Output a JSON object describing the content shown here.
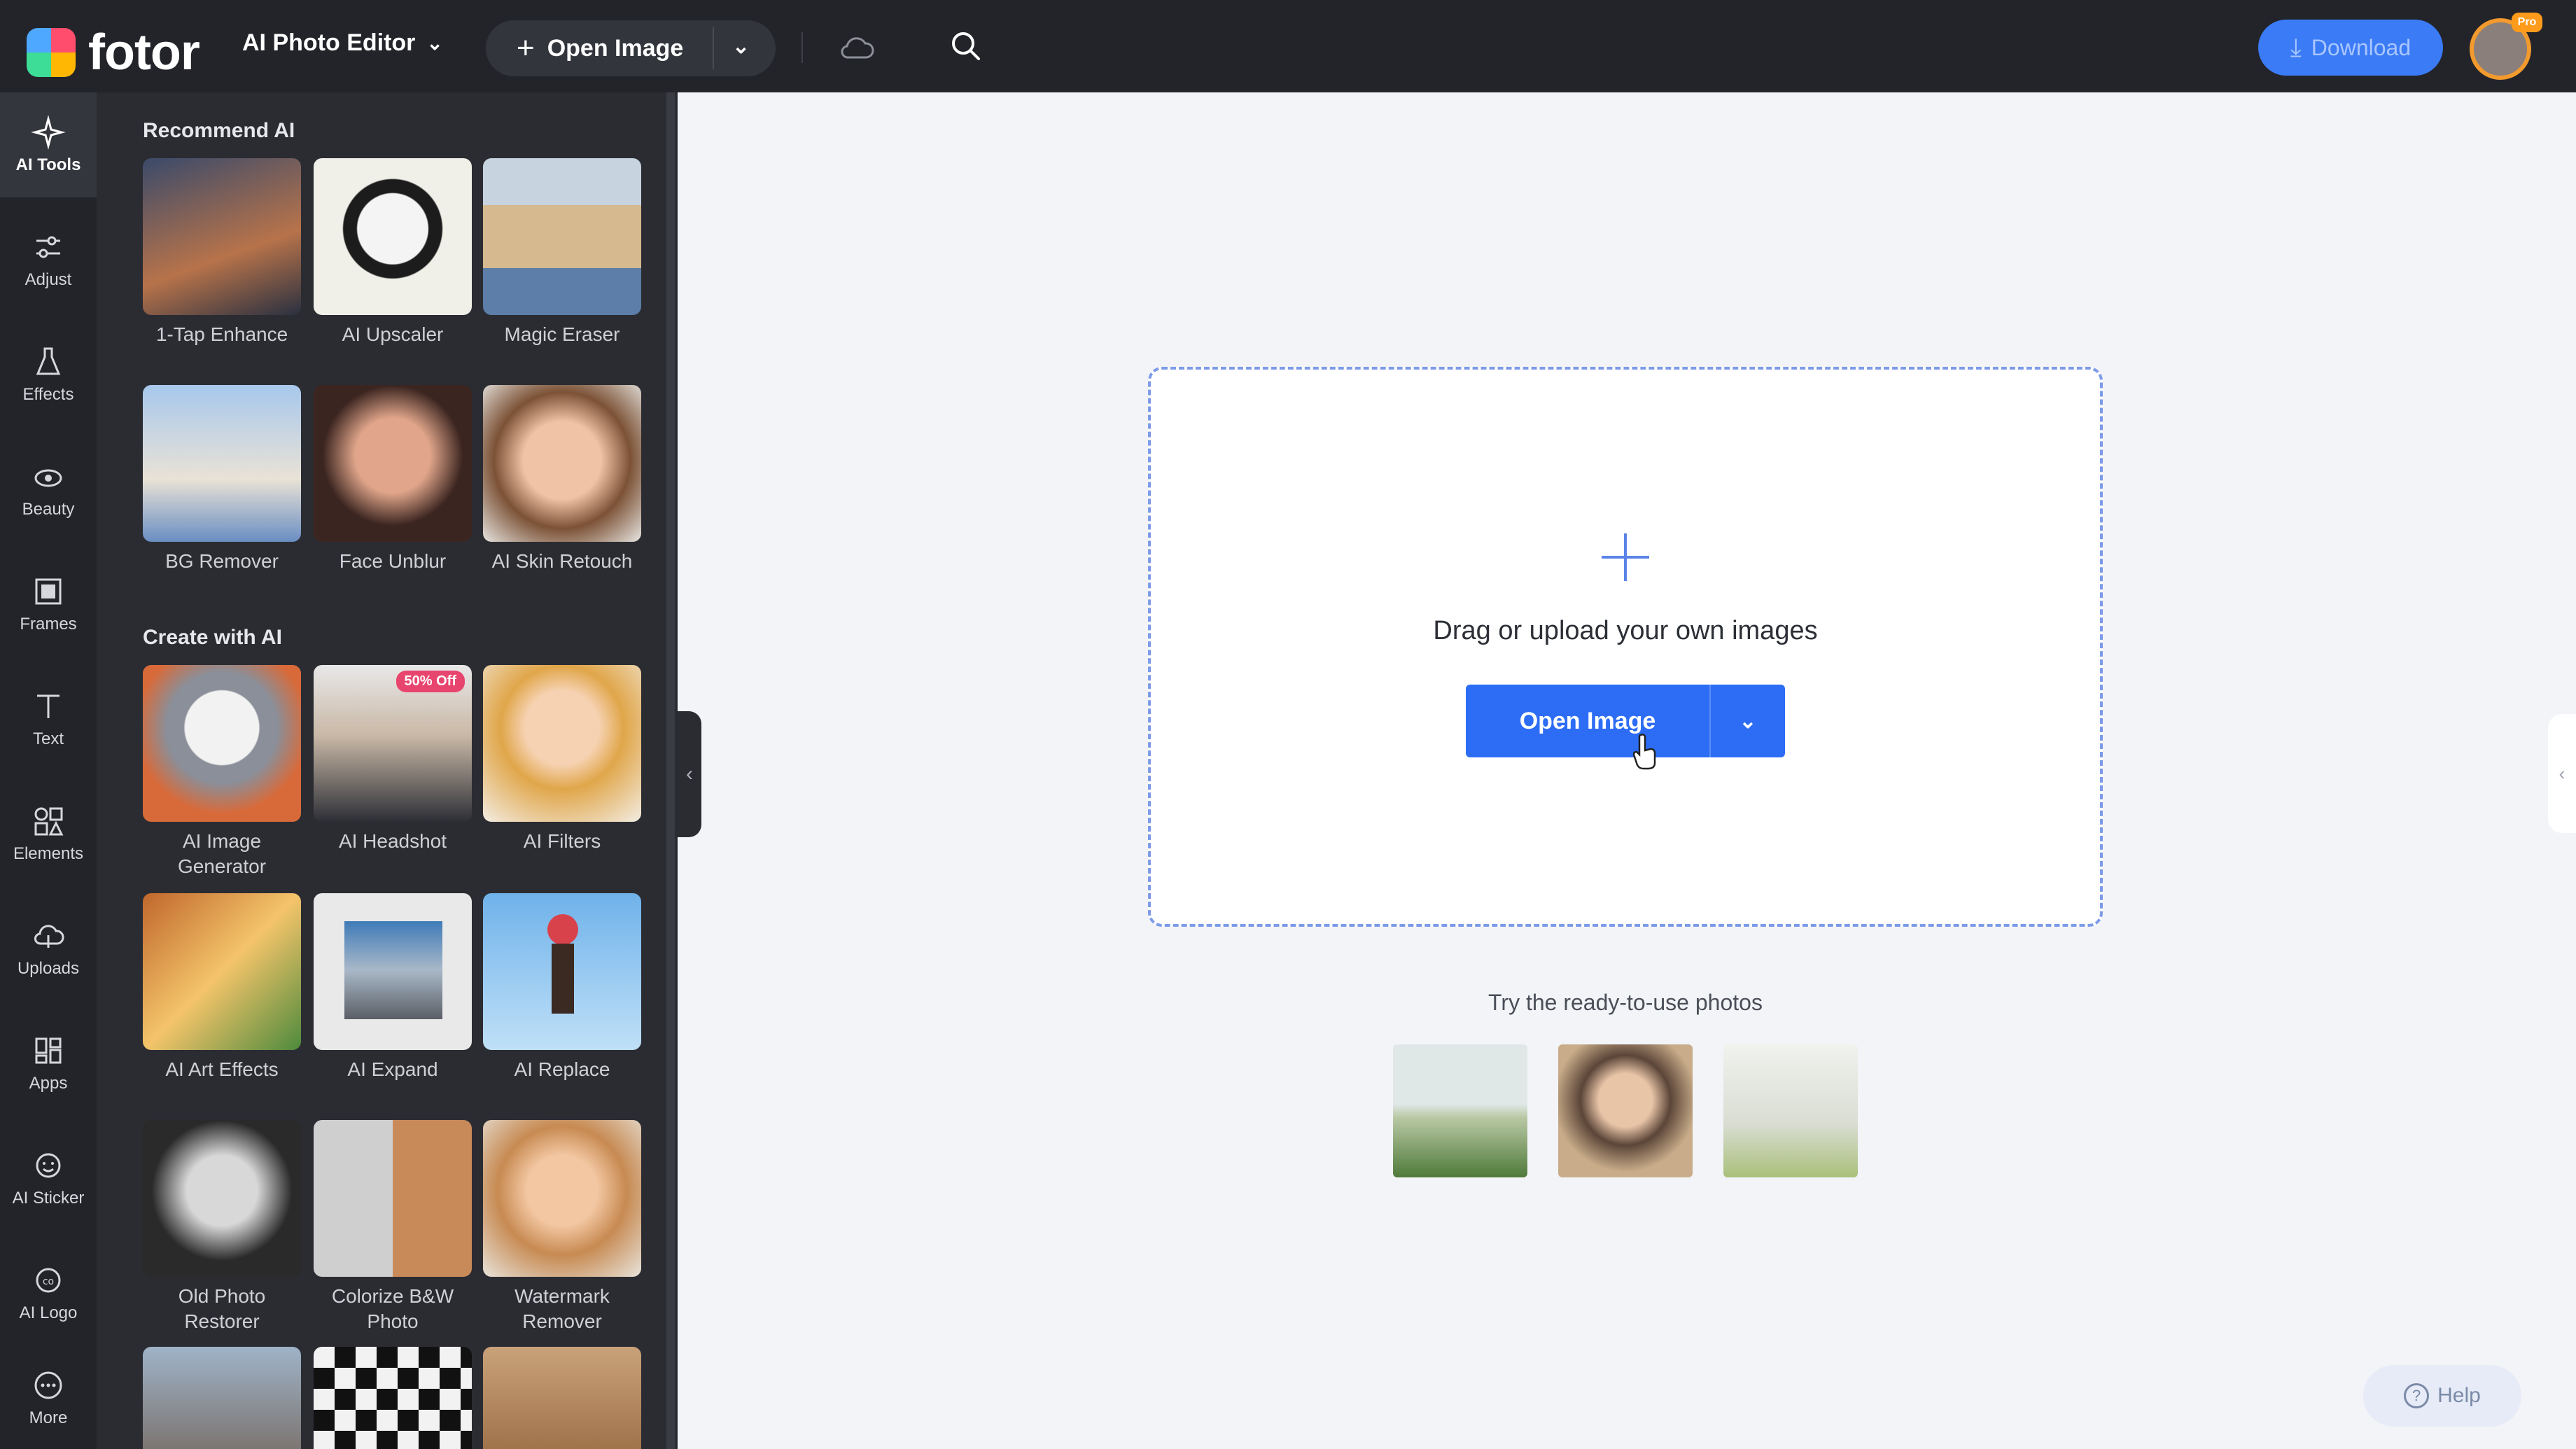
{
  "topbar": {
    "logo_text": "fotor",
    "editor_menu": "AI Photo Editor",
    "open_image_label": "Open Image",
    "download_label": "Download",
    "pro_badge": "Pro"
  },
  "rail": {
    "items": [
      {
        "label": "AI Tools",
        "icon": "sparkle-icon"
      },
      {
        "label": "Adjust",
        "icon": "sliders-icon"
      },
      {
        "label": "Effects",
        "icon": "flask-icon"
      },
      {
        "label": "Beauty",
        "icon": "eye-icon"
      },
      {
        "label": "Frames",
        "icon": "frame-icon"
      },
      {
        "label": "Text",
        "icon": "text-icon"
      },
      {
        "label": "Elements",
        "icon": "shapes-icon"
      },
      {
        "label": "Uploads",
        "icon": "upload-cloud-icon"
      },
      {
        "label": "Apps",
        "icon": "apps-icon"
      },
      {
        "label": "AI Sticker",
        "icon": "sticker-icon"
      },
      {
        "label": "AI Logo",
        "icon": "logo-icon"
      },
      {
        "label": "More",
        "icon": "more-icon"
      }
    ]
  },
  "panel": {
    "section_recommend": "Recommend AI",
    "section_create": "Create with AI",
    "recommend_tools": [
      {
        "label": "1-Tap Enhance"
      },
      {
        "label": "AI Upscaler"
      },
      {
        "label": "Magic Eraser"
      },
      {
        "label": "BG Remover"
      },
      {
        "label": "Face Unblur"
      },
      {
        "label": "AI Skin Retouch"
      }
    ],
    "create_tools": [
      {
        "label": "AI Image Generator"
      },
      {
        "label": "AI Headshot",
        "badge": "50% Off"
      },
      {
        "label": "AI Filters"
      },
      {
        "label": "AI Art Effects"
      },
      {
        "label": "AI Expand"
      },
      {
        "label": "AI Replace"
      },
      {
        "label": "Old Photo Restorer"
      },
      {
        "label": "Colorize B&W Photo"
      },
      {
        "label": "Watermark Remover"
      }
    ]
  },
  "canvas": {
    "drop_text": "Drag or upload your own images",
    "open_image_label": "Open Image",
    "try_text": "Try the ready-to-use photos",
    "help_label": "Help"
  },
  "colors": {
    "accent": "#2d6df5",
    "topbar_bg": "#23242a",
    "panel_bg": "#2b2c32",
    "canvas_bg": "#f3f4f8"
  }
}
